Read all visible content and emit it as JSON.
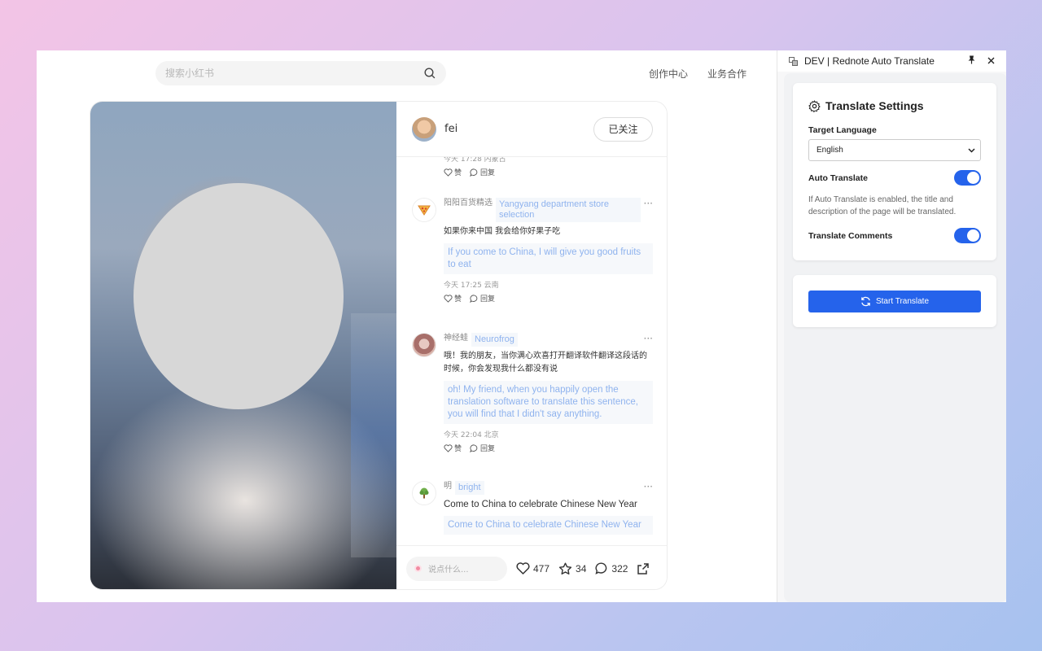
{
  "page": {
    "search": {
      "placeholder": "搜索小红书"
    },
    "nav": [
      "创作中心",
      "业务合作"
    ],
    "note": {
      "author": {
        "name": "fei",
        "follow_label": "已关注"
      },
      "partial_comment": {
        "meta": "今天 17:28 内蒙古",
        "like": "赞",
        "reply": "回复"
      },
      "comments": [
        {
          "name": "阳阳百货精选",
          "name_translated": "Yangyang department store selection",
          "text": "如果你来中国 我会给你好果子吃",
          "text_translated": "If you come to China, I will give you good fruits to eat",
          "meta": "今天 17:25 云南",
          "like": "赞",
          "reply": "回复",
          "avatar_icon": "pizza-icon"
        },
        {
          "name": "神经蛙",
          "name_translated": "Neurofrog",
          "text": "哦！我的朋友，当你满心欢喜打开翻译软件翻译这段话的时候，你会发现我什么都没有说",
          "text_translated": "oh! My friend, when you happily open the translation software to translate this sentence, you will find that I didn't say anything.",
          "meta": "今天 22:04 北京",
          "like": "赞",
          "reply": "回复",
          "avatar_icon": "frog-avatar-icon"
        },
        {
          "name": "明",
          "name_translated": "bright",
          "text": "Come to China to celebrate Chinese New Year",
          "text_translated": "Come to China to celebrate Chinese New Year",
          "avatar_icon": "tree-icon"
        }
      ],
      "more_glyph": "···",
      "bottom": {
        "say_placeholder": "说点什么...",
        "likes": "477",
        "stars": "34",
        "comments": "322"
      }
    }
  },
  "extension": {
    "window_title": "DEV | Rednote Auto Translate",
    "settings_title": "Translate Settings",
    "target_language_label": "Target Language",
    "target_language_value": "English",
    "auto_translate_label": "Auto Translate",
    "auto_translate_on": true,
    "auto_translate_hint": "If Auto Translate is enabled, the title and description of the page will be translated.",
    "translate_comments_label": "Translate Comments",
    "translate_comments_on": true,
    "start_button": "Start Translate",
    "accent_color": "#2563eb"
  }
}
